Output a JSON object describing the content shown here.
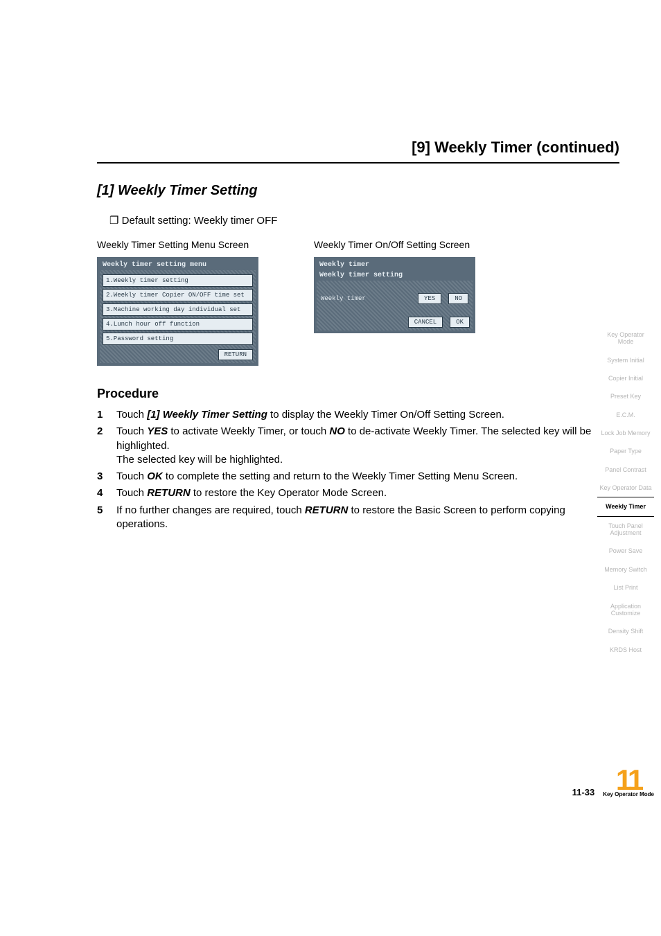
{
  "header": {
    "title": "[9] Weekly Timer (continued)"
  },
  "subsection": {
    "title": "[1] Weekly Timer Setting"
  },
  "default_setting": "Default setting: Weekly timer OFF",
  "screen1": {
    "caption": "Weekly Timer Setting Menu Screen",
    "title": "Weekly timer setting menu",
    "items": [
      "1.Weekly timer setting",
      "2.Weekly timer Copier ON/OFF time set",
      "3.Machine working day individual set",
      "4.Lunch hour off function",
      "5.Password setting"
    ],
    "return_label": "RETURN"
  },
  "screen2": {
    "caption": "Weekly Timer On/Off Setting Screen",
    "title_line1": "Weekly timer",
    "title_line2": "Weekly timer setting",
    "row_label": "Weekly timer",
    "yes_label": "YES",
    "no_label": "NO",
    "cancel_label": "CANCEL",
    "ok_label": "OK"
  },
  "procedure": {
    "title": "Procedure",
    "steps": [
      "Touch [1] Weekly timer setting to display the Weekly Timer On/Off Setting Screen.",
      "Touch YES to activate Weekly Timer, or touch NO to de-activate Weekly Timer. The selected key will be highlighted.\nThe selected key will be highlighted.",
      "Touch OK to complete the setting and return to the Weekly Timer Setting Menu Screen.",
      "Touch RETURN to restore the Key Operator Mode Screen.",
      "If no further changes are required, touch RETURN to restore the Basic Screen to perform copying operations."
    ]
  },
  "sidebar": [
    {
      "label": "Key Operator Mode",
      "active": false
    },
    {
      "label": "System Initial",
      "active": false
    },
    {
      "label": "Copier Initial",
      "active": false
    },
    {
      "label": "Preset Key",
      "active": false
    },
    {
      "label": "E.C.M.",
      "active": false
    },
    {
      "label": "Lock Job Memory",
      "active": false
    },
    {
      "label": "Paper Type",
      "active": false
    },
    {
      "label": "Panel Contrast",
      "active": false
    },
    {
      "label": "Key Operator Data",
      "active": false
    },
    {
      "label": "Weekly Timer",
      "active": true
    },
    {
      "label": "Touch Panel Adjustment",
      "active": false
    },
    {
      "label": "Power Save",
      "active": false
    },
    {
      "label": "Memory Switch",
      "active": false
    },
    {
      "label": "List Print",
      "active": false
    },
    {
      "label": "Application Customize",
      "active": false
    },
    {
      "label": "Density Shift",
      "active": false
    },
    {
      "label": "KRDS Host",
      "active": false
    }
  ],
  "footer": {
    "page_number": "11-33",
    "chapter_number": "11",
    "chapter_label": "Key Operator Mode"
  }
}
